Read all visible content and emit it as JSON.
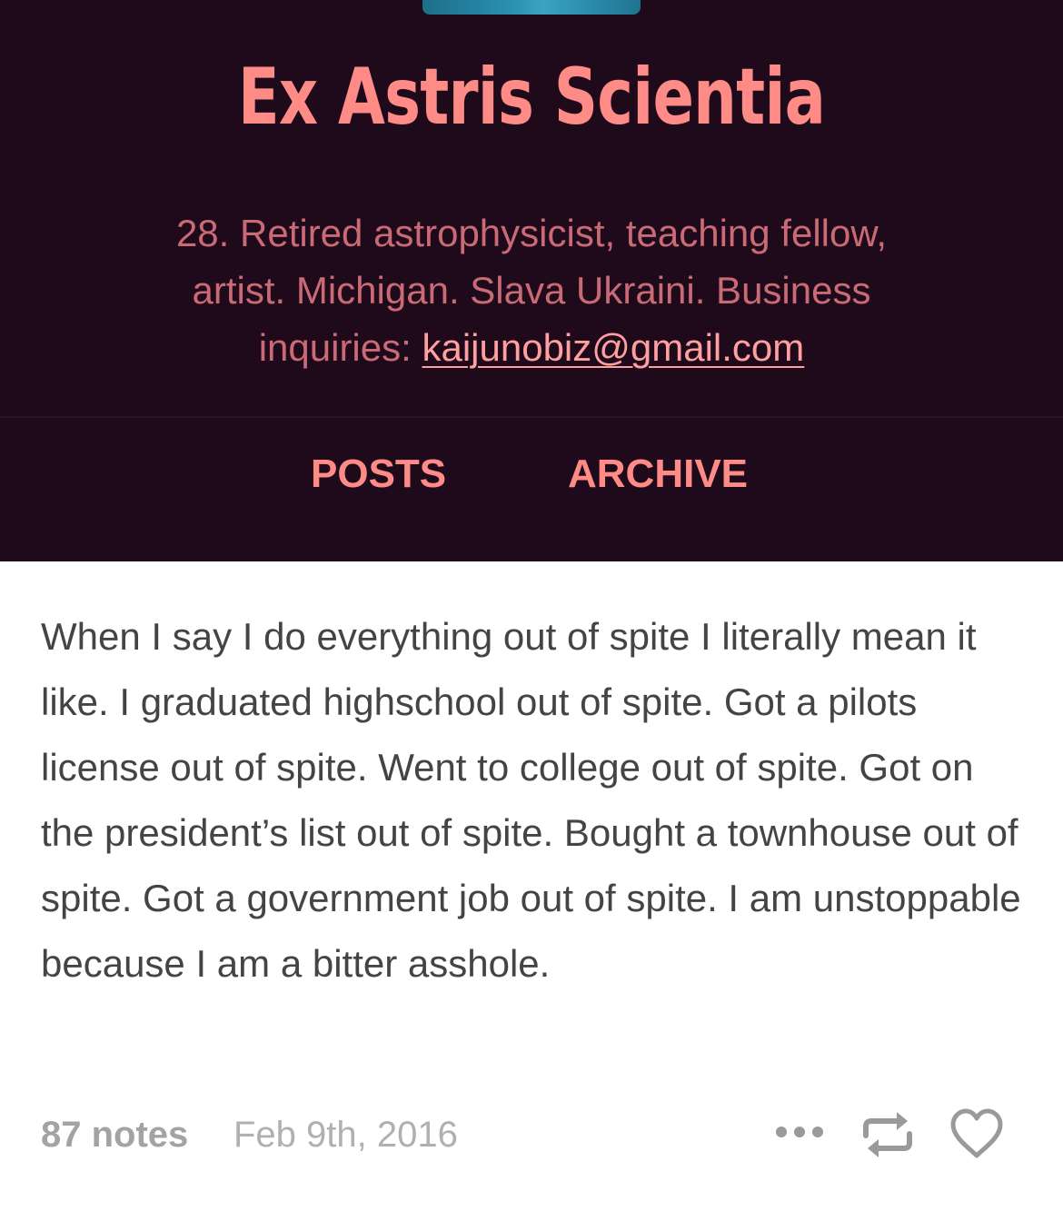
{
  "header": {
    "title": "Ex Astris Scientia",
    "description_text": "28. Retired astrophysicist, teaching fellow, artist. Michigan. Slava Ukraini. Business inquiries: ",
    "email": "kaijunobiz@gmail.com",
    "nav": {
      "posts": "POSTS",
      "archive": "ARCHIVE"
    }
  },
  "post": {
    "body": "When I say I do everything out of spite I literally mean it like. I graduated highschool out of spite. Got a pilots license out of spite. Went to college out of spite. Got on the president’s list out of spite. Bought a townhouse out of spite. Got a government job out of spite. I am unstoppable because I am a bitter asshole.",
    "notes": "87 notes",
    "date": "Feb 9th, 2016"
  },
  "icons": {
    "more": "more-dots-icon",
    "reblog": "reblog-icon",
    "like": "heart-icon"
  },
  "colors": {
    "header_bg": "#1f0a1c",
    "accent": "#ff8b86",
    "description": "#c96a75",
    "body_text": "#444444",
    "meta_text": "#a3a3a3"
  }
}
